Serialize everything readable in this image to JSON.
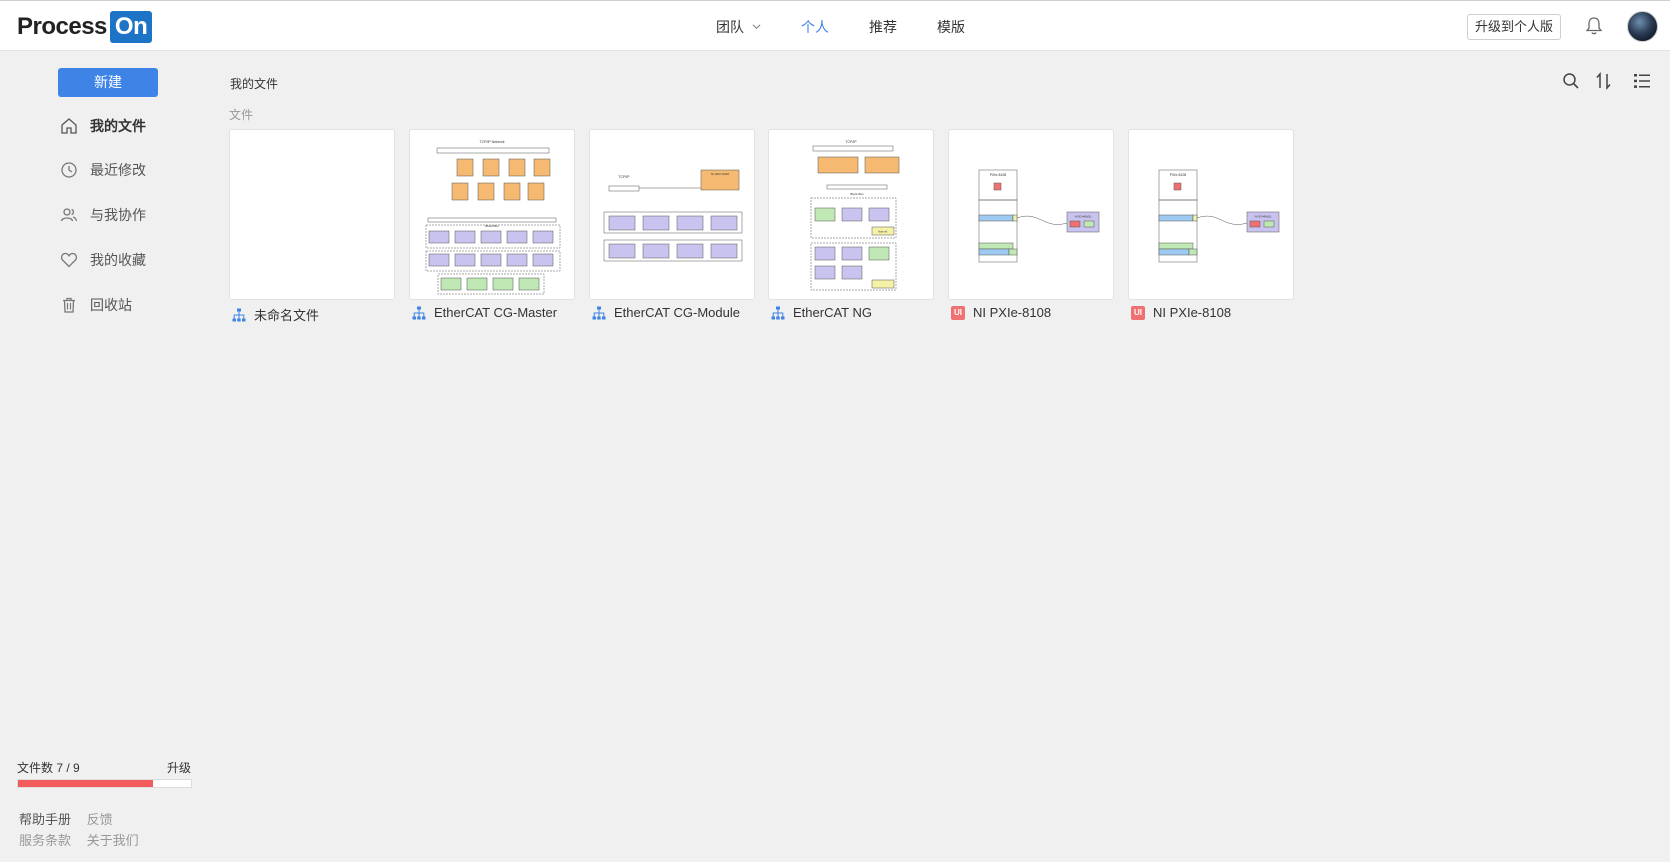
{
  "brand": {
    "logo_text": "Process",
    "logo_box": "On"
  },
  "nav": {
    "team": "团队",
    "personal": "个人",
    "recommend": "推荐",
    "templates": "模版"
  },
  "header": {
    "upgrade_button": "升级到个人版"
  },
  "sidebar": {
    "new_button": "新建",
    "items": [
      {
        "label": "我的文件",
        "icon": "home-icon"
      },
      {
        "label": "最近修改",
        "icon": "clock-icon"
      },
      {
        "label": "与我协作",
        "icon": "users-icon"
      },
      {
        "label": "我的收藏",
        "icon": "heart-icon"
      },
      {
        "label": "回收站",
        "icon": "trash-icon"
      }
    ],
    "quota": {
      "label": "文件数 7 / 9",
      "upgrade": "升级",
      "used": 7,
      "total": 9
    },
    "footer": {
      "help": "帮助手册",
      "feedback": "反馈",
      "terms": "服务条款",
      "about": "关于我们"
    }
  },
  "main": {
    "breadcrumb": "我的文件",
    "section_label": "文件",
    "files": [
      {
        "name": "未命名文件",
        "type": "flowchart"
      },
      {
        "name": "EtherCAT CG-Master",
        "type": "flowchart"
      },
      {
        "name": "EtherCAT CG-Module",
        "type": "flowchart"
      },
      {
        "name": "EtherCAT NG",
        "type": "flowchart"
      },
      {
        "name": "NI PXIe-8108",
        "type": "ui",
        "icon_text": "UI"
      },
      {
        "name": "NI PXIe-8108",
        "type": "ui",
        "icon_text": "UI"
      }
    ]
  },
  "thumbs": {
    "master": {
      "title": "TCP/IP Network",
      "bus": "Block Bus"
    },
    "module": {
      "title": "TCP/IP",
      "ctrl": "NI cRIO 9022"
    },
    "ng": {
      "title": "TCP/IP",
      "bus": "Block Bus",
      "note": "Note ref."
    },
    "pxi": {
      "title": "PXIe-8108",
      "box": "NI 9144(M1)"
    }
  },
  "colors": {
    "accent": "#3e83e6",
    "quota": "#f25c5c",
    "brand_box": "#1d74c6",
    "ui_icon": "#f07171"
  }
}
